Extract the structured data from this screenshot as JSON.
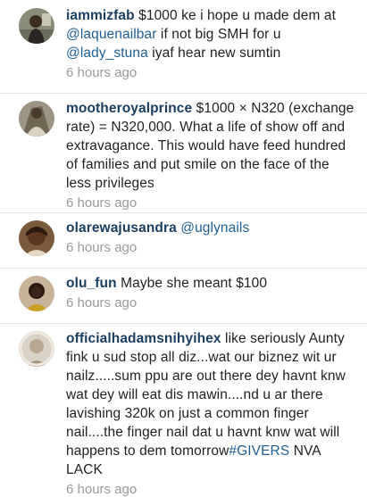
{
  "comments": [
    {
      "username": "iammizfab",
      "text": "$1000 ke i hope u made dem at ",
      "mention1": "@laquenailbar",
      "text2": " if not big SMH for u ",
      "mention2": "@lady_stuna",
      "text3": " iyaf hear new sumtin",
      "time": "6 hours ago"
    },
    {
      "username": "mootheroyalprince",
      "text": "$1000 × N320 (exchange rate) = N320,000. What a life of show off and extravagance. This would have feed hundred of families and put smile on the face of the less privileges",
      "time": "6 hours ago"
    },
    {
      "username": "olarewajusandra",
      "mention1": "@uglynails",
      "time": "6 hours ago"
    },
    {
      "username": "olu_fun",
      "text": "Maybe she meant $100",
      "time": "6 hours ago"
    },
    {
      "username": "officialhadamsnihyihex",
      "text": "like seriously Aunty fink u sud stop all diz...wat our biznez wit ur nailz.....sum ppu are out there dey havnt knw wat dey will eat dis mawin....nd u ar there lavishing 320k on just a common finger nail....the finger nail dat u havnt knw wat will happens to dem tomorrow",
      "hashtag": "#GIVERS",
      "text2": " NVA LACK",
      "time": "6 hours ago"
    }
  ]
}
